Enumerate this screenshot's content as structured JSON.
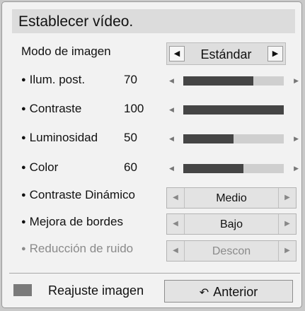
{
  "title": "Establecer vídeo.",
  "picture_mode": {
    "label": "Modo de imagen",
    "value": "Estándar",
    "left_icon": "left-triangle-icon",
    "right_icon": "right-triangle-icon"
  },
  "sliders": [
    {
      "label": "Ilum. post.",
      "value": "70",
      "level": 70
    },
    {
      "label": "Contraste",
      "value": "100",
      "level": 100
    },
    {
      "label": "Luminosidad",
      "value": "50",
      "level": 50
    },
    {
      "label": "Color",
      "value": "60",
      "level": 60
    }
  ],
  "selects": [
    {
      "label": "Contraste Dinámico",
      "value": "Medio",
      "enabled": true
    },
    {
      "label": "Mejora de bordes",
      "value": "Bajo",
      "enabled": true
    },
    {
      "label": "Reducción de ruido",
      "value": "Descon",
      "enabled": false
    }
  ],
  "footer": {
    "reset_label": "Reajuste imagen",
    "back_label": "Anterior",
    "back_icon": "return-arrow-icon",
    "key_color": "#7a7a7a"
  },
  "colors": {
    "panel_bg": "#f2f2f2",
    "title_bg": "#dcdcdc",
    "slider_fill": "#454545",
    "slider_track": "#cfcfcf",
    "disabled_text": "#8a8a8a"
  }
}
